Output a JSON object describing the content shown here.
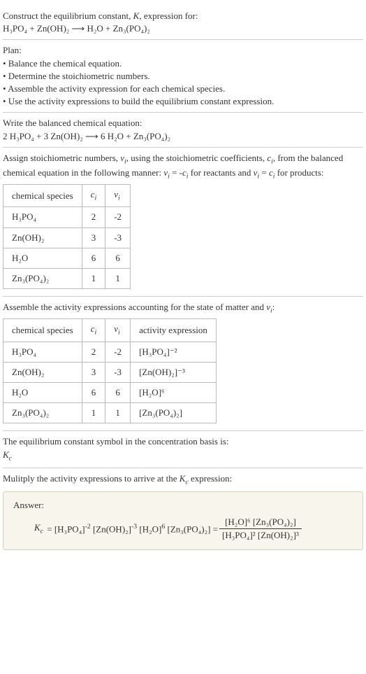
{
  "intro": {
    "line1": "Construct the equilibrium constant, K, expression for:",
    "equation": "H₃PO₄ + Zn(OH)₂  ⟶  H₂O + Zn₃(PO₄)₂"
  },
  "plan": {
    "heading": "Plan:",
    "items": [
      "• Balance the chemical equation.",
      "• Determine the stoichiometric numbers.",
      "• Assemble the activity expression for each chemical species.",
      "• Use the activity expressions to build the equilibrium constant expression."
    ]
  },
  "balanced": {
    "heading": "Write the balanced chemical equation:",
    "equation": "2 H₃PO₄ + 3 Zn(OH)₂  ⟶  6 H₂O + Zn₃(PO₄)₂"
  },
  "stoich": {
    "intro": "Assign stoichiometric numbers, νᵢ, using the stoichiometric coefficients, cᵢ, from the balanced chemical equation in the following manner: νᵢ = -cᵢ for reactants and νᵢ = cᵢ for products:",
    "headers": [
      "chemical species",
      "cᵢ",
      "νᵢ"
    ],
    "rows": [
      {
        "sp": "H₃PO₄",
        "c": "2",
        "v": "-2"
      },
      {
        "sp": "Zn(OH)₂",
        "c": "3",
        "v": "-3"
      },
      {
        "sp": "H₂O",
        "c": "6",
        "v": "6"
      },
      {
        "sp": "Zn₃(PO₄)₂",
        "c": "1",
        "v": "1"
      }
    ]
  },
  "activity": {
    "intro": "Assemble the activity expressions accounting for the state of matter and νᵢ:",
    "headers": [
      "chemical species",
      "cᵢ",
      "νᵢ",
      "activity expression"
    ],
    "rows": [
      {
        "sp": "H₃PO₄",
        "c": "2",
        "v": "-2",
        "a": "[H₃PO₄]⁻²"
      },
      {
        "sp": "Zn(OH)₂",
        "c": "3",
        "v": "-3",
        "a": "[Zn(OH)₂]⁻³"
      },
      {
        "sp": "H₂O",
        "c": "6",
        "v": "6",
        "a": "[H₂O]⁶"
      },
      {
        "sp": "Zn₃(PO₄)₂",
        "c": "1",
        "v": "1",
        "a": "[Zn₃(PO₄)₂]"
      }
    ]
  },
  "symbol": {
    "line1": "The equilibrium constant symbol in the concentration basis is:",
    "line2": "K꜀"
  },
  "multiply": "Mulitply the activity expressions to arrive at the K꜀ expression:",
  "answer": {
    "label": "Answer:",
    "lhs": "K꜀ = [H₃PO₄]⁻² [Zn(OH)₂]⁻³ [H₂O]⁶ [Zn₃(PO₄)₂] = ",
    "frac_num": "[H₂O]⁶ [Zn₃(PO₄)₂]",
    "frac_den": "[H₃PO₄]² [Zn(OH)₂]³"
  }
}
